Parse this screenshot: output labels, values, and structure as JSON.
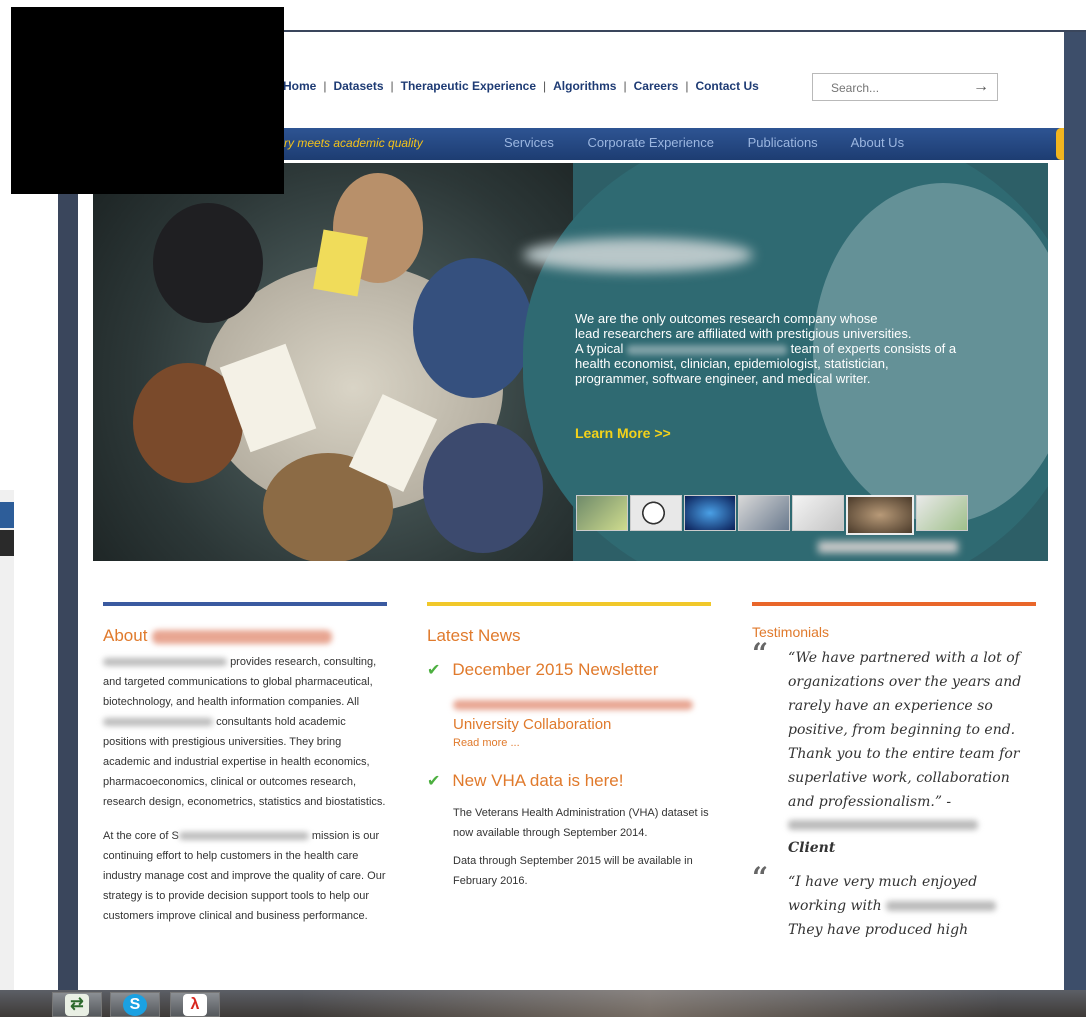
{
  "top_nav": {
    "items": [
      "Home",
      "Datasets",
      "Therapeutic Experience",
      "Algorithms",
      "Careers",
      "Contact Us"
    ],
    "separator": "|"
  },
  "search": {
    "placeholder": "Search...",
    "submit_icon": "right-arrow-icon"
  },
  "blue_bar": {
    "tagline": "ry meets academic quality",
    "items": [
      "Services",
      "Corporate Experience",
      "Publications",
      "About Us"
    ]
  },
  "hero": {
    "line1": "We are the only outcomes research company whose",
    "line2": "lead researchers are affiliated with prestigious universities.",
    "line3_start": "A typical",
    "line3_end": "team of experts consists of a",
    "line4": "health economist, clinician, epidemiologist, statistician,",
    "line5": "programmer, software engineer, and medical writer.",
    "learn_more": "Learn More >>"
  },
  "about": {
    "heading": "About",
    "p1": "provides research, consulting, and targeted communications to global pharmaceutical, biotechnology, and health information companies. All",
    "p1b": "consultants hold academic positions with prestigious universities. They bring academic and industrial expertise in health economics, pharmacoeconomics, clinical or outcomes research, research design, econometrics, statistics and biostatistics.",
    "p2a": "At the core of S",
    "p2b": "mission is our continuing effort to help customers in the health care industry manage cost and improve the quality of care. Our strategy is to provide decision support tools to help our customers improve clinical and business performance."
  },
  "news": {
    "heading": "Latest News",
    "item1_title": "December 2015 Newsletter",
    "item1_link": "University Collaboration",
    "item1_more": "Read more ...",
    "item2_title": "New VHA data is here!",
    "item2_p1": "The Veterans Health Administration (VHA) dataset is now available through September 2014.",
    "item2_p2": "Data through September 2015 will be available in February 2016."
  },
  "testimonials": {
    "heading": "Testimonials",
    "quote1": "“We have partnered with a lot of organizations over the years and rarely have an experience so positive, from beginning to end. Thank you to the entire team for superlative work, collaboration and professionalism.” -",
    "quote1_client": "Client",
    "quote2_a": "“I have very much enjoyed working with",
    "quote2_b": "They have produced high"
  },
  "taskbar": {
    "icons": [
      "switch-windows-icon",
      "skype-icon",
      "acrobat-icon"
    ]
  },
  "colors": {
    "nav_blue": "#1e3b74",
    "bar_blue": "#2e5493",
    "tagline_yellow": "#f3c21a",
    "accent_orange": "#e07a2c",
    "hero_teal": "#2d5f67",
    "about_bar": "#3a5aa0",
    "news_bar": "#f1c82a",
    "test_bar": "#e9662a"
  }
}
